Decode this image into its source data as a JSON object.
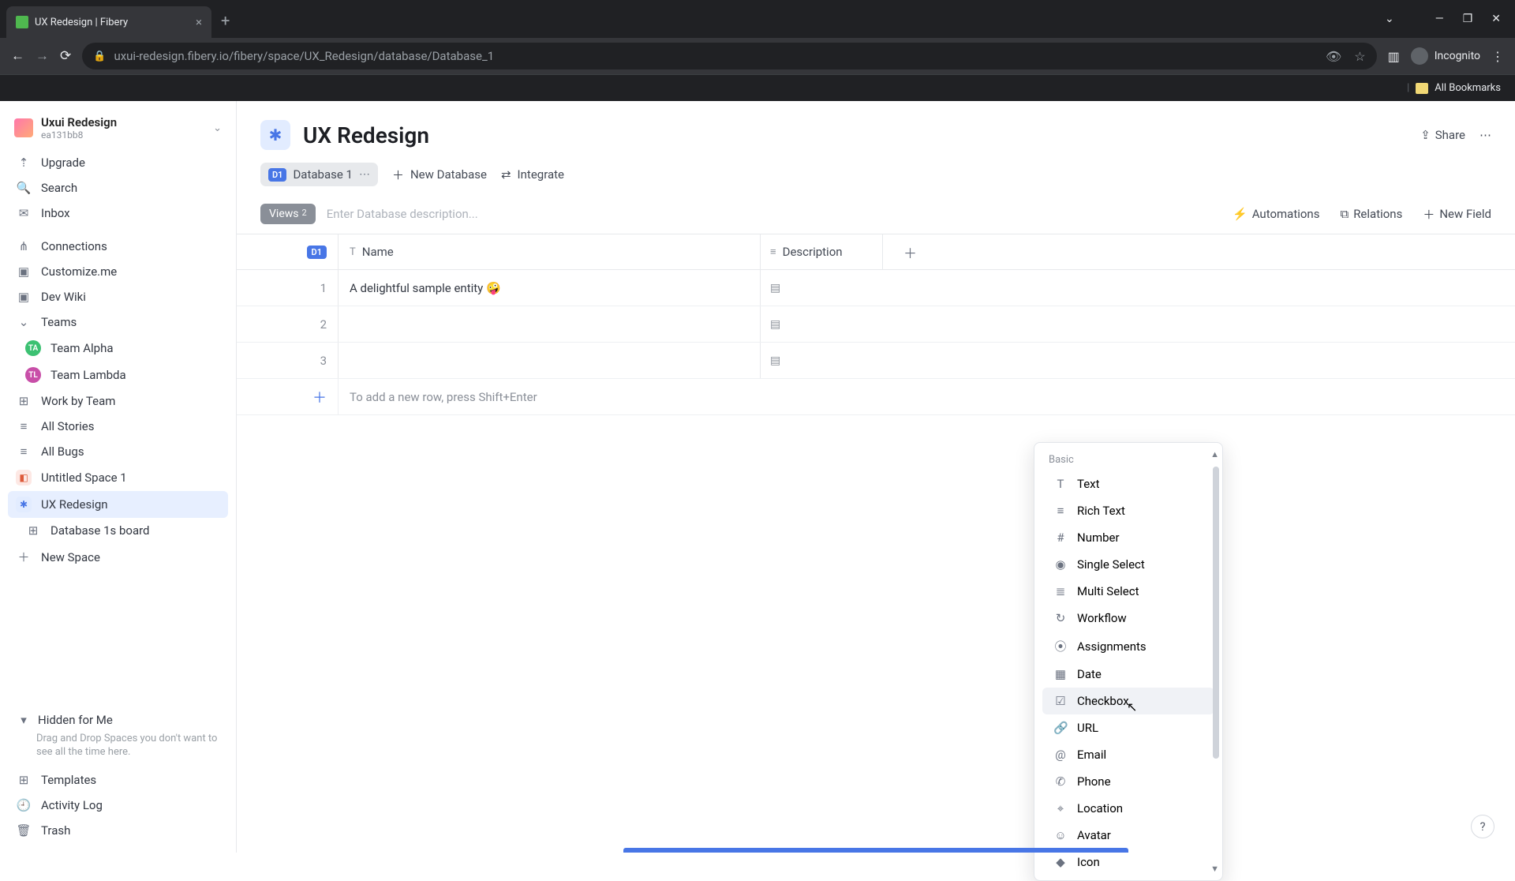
{
  "browser": {
    "tab_title": "UX Redesign | Fibery",
    "url": "uxui-redesign.fibery.io/fibery/space/UX_Redesign/database/Database_1",
    "incognito_label": "Incognito",
    "bookmarks_label": "All Bookmarks"
  },
  "workspace": {
    "name": "Uxui Redesign",
    "id": "ea131bb8"
  },
  "sidebar": {
    "upgrade": "Upgrade",
    "search": "Search",
    "inbox": "Inbox",
    "connections": "Connections",
    "customize": "Customize.me",
    "dev_wiki": "Dev Wiki",
    "teams": "Teams",
    "team_alpha": "Team Alpha",
    "team_lambda": "Team Lambda",
    "work_by_team": "Work by Team",
    "all_stories": "All Stories",
    "all_bugs": "All Bugs",
    "untitled": "Untitled Space 1",
    "ux": "UX Redesign",
    "db_board": "Database 1s board",
    "new_space": "New Space",
    "hidden": "Hidden for Me",
    "hidden_desc": "Drag and Drop Spaces you don't want to see all the time here.",
    "templates": "Templates",
    "activity": "Activity Log",
    "trash": "Trash"
  },
  "header": {
    "title": "UX Redesign",
    "share": "Share"
  },
  "tabs": {
    "db1": "Database 1",
    "new_db": "New Database",
    "integrate": "Integrate"
  },
  "toolbar": {
    "views": "Views",
    "views_count": "2",
    "desc_placeholder": "Enter Database description...",
    "automations": "Automations",
    "relations": "Relations",
    "new_field": "New Field"
  },
  "table": {
    "d1": "D1",
    "name_hdr": "Name",
    "desc_hdr": "Description",
    "row1": "A delightful sample entity 🤪",
    "add_hint": "To add a new row, press Shift+Enter"
  },
  "dropdown": {
    "section": "Basic",
    "items": [
      {
        "label": "Text",
        "icon": "T"
      },
      {
        "label": "Rich Text",
        "icon": "≡"
      },
      {
        "label": "Number",
        "icon": "#"
      },
      {
        "label": "Single Select",
        "icon": "◉"
      },
      {
        "label": "Multi Select",
        "icon": "≣"
      },
      {
        "label": "Workflow",
        "icon": "↻"
      },
      {
        "label": "Assignments",
        "icon": "⦿"
      },
      {
        "label": "Date",
        "icon": "▦"
      },
      {
        "label": "Checkbox",
        "icon": "☑",
        "hov": true
      },
      {
        "label": "URL",
        "icon": "🔗"
      },
      {
        "label": "Email",
        "icon": "@"
      },
      {
        "label": "Phone",
        "icon": "✆"
      },
      {
        "label": "Location",
        "icon": "⌖"
      },
      {
        "label": "Avatar",
        "icon": "☺"
      },
      {
        "label": "Icon",
        "icon": "◆"
      }
    ]
  }
}
